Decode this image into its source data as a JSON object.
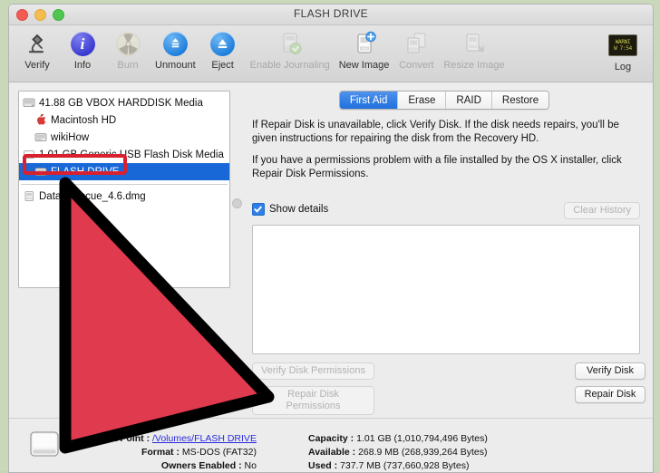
{
  "window": {
    "title": "FLASH DRIVE",
    "traffic_lights": [
      "close-button",
      "minimize-button",
      "maximize-button"
    ]
  },
  "toolbar": {
    "items": [
      {
        "label": "Verify",
        "icon": "microscope-icon",
        "enabled": true
      },
      {
        "label": "Info",
        "icon": "info-circle-icon",
        "enabled": true
      },
      {
        "label": "Burn",
        "icon": "radiation-burn-icon",
        "enabled": false
      },
      {
        "label": "Unmount",
        "icon": "unmount-icon",
        "enabled": true
      },
      {
        "label": "Eject",
        "icon": "eject-icon",
        "enabled": true
      },
      {
        "label": "Enable Journaling",
        "icon": "journaling-disk-icon",
        "enabled": false
      },
      {
        "label": "New Image",
        "icon": "new-image-icon",
        "enabled": true
      },
      {
        "label": "Convert",
        "icon": "convert-icon",
        "enabled": false
      },
      {
        "label": "Resize Image",
        "icon": "resize-image-icon",
        "enabled": false
      }
    ],
    "log": {
      "label": "Log",
      "icon": "log-display-icon",
      "screen_line1": "WARNI",
      "screen_line2": "W 7:54"
    }
  },
  "sidebar": {
    "items": [
      {
        "label": "41.88 GB VBOX HARDDISK Media",
        "icon": "hard-disk-icon",
        "indent": false,
        "selected": false
      },
      {
        "label": "Macintosh HD",
        "icon": "mac-volume-icon",
        "indent": true,
        "selected": false
      },
      {
        "label": "wikiHow",
        "icon": "volume-icon",
        "indent": true,
        "selected": false
      },
      {
        "label": "1.01 GB Generic USB Flash Disk Media",
        "icon": "usb-disk-icon",
        "indent": false,
        "selected": false
      },
      {
        "label": "FLASH DRIVE",
        "icon": "volume-icon",
        "indent": true,
        "selected": true
      }
    ],
    "separator": true,
    "images": [
      {
        "label": "Data_Rescue_4.6.dmg",
        "icon": "dmg-icon"
      }
    ]
  },
  "pane": {
    "tabs": [
      {
        "label": "First Aid",
        "active": true
      },
      {
        "label": "Erase",
        "active": false
      },
      {
        "label": "RAID",
        "active": false
      },
      {
        "label": "Restore",
        "active": false
      }
    ],
    "paragraph1": "If Repair Disk is unavailable, click Verify Disk. If the disk needs repairs, you'll be given instructions for repairing the disk from the Recovery HD.",
    "paragraph2": "If you have a permissions problem with a file installed by the OS X installer, click Repair Disk Permissions.",
    "show_details_label": "Show details",
    "show_details_checked": true,
    "clear_history_label": "Clear History",
    "clear_history_enabled": false,
    "log_area_text": "",
    "buttons": [
      {
        "label": "Verify Disk Permissions",
        "enabled": false
      },
      {
        "label": "Repair Disk Permissions",
        "enabled": false
      },
      {
        "label": "Verify Disk",
        "enabled": true
      },
      {
        "label": "Repair Disk",
        "enabled": true
      }
    ]
  },
  "footer": {
    "left": [
      {
        "label": "Mount Point :",
        "value": "/Volumes/FLASH DRIVE",
        "link": true
      },
      {
        "label": "Format :",
        "value": "MS-DOS (FAT32)",
        "link": false
      },
      {
        "label": "Owners Enabled :",
        "value": "No",
        "link": false
      }
    ],
    "right": [
      {
        "label": "Capacity :",
        "value": "1.01 GB (1,010,794,496 Bytes)"
      },
      {
        "label": "Available :",
        "value": "268.9 MB (268,939,264 Bytes)"
      },
      {
        "label": "Used :",
        "value": "737.7 MB (737,660,928 Bytes)"
      }
    ],
    "icon": "external-drive-icon"
  },
  "annotations": {
    "highlight_box": {
      "target": "FLASH DRIVE",
      "color": "#d8202e"
    },
    "cursor": {
      "type": "arrow-pointer",
      "color": "#e03a4e"
    }
  }
}
